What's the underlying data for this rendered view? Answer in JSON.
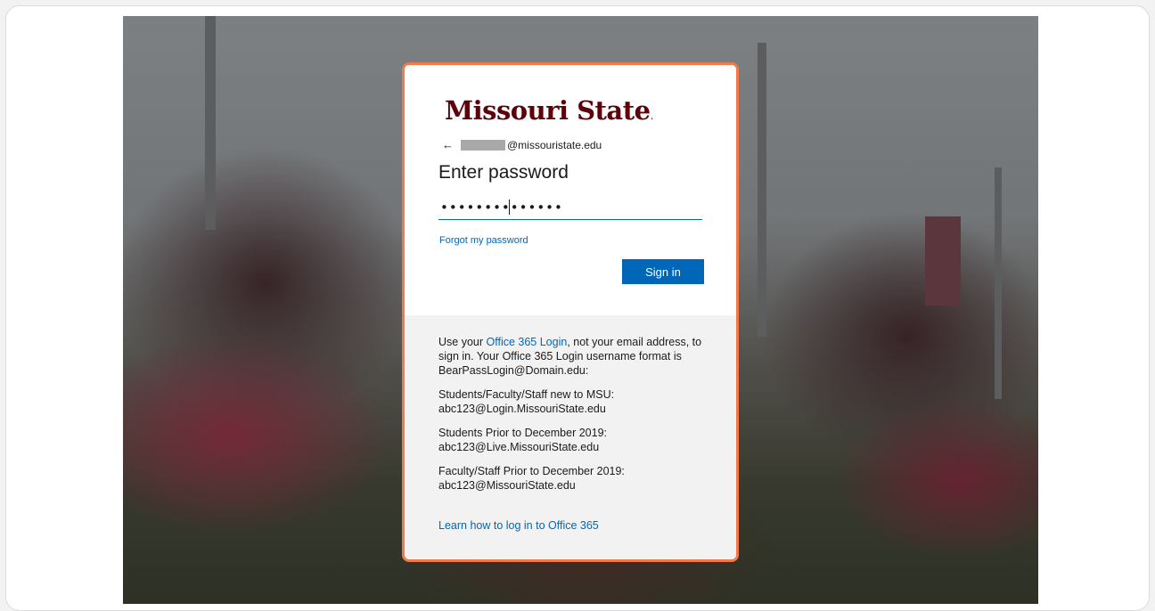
{
  "brand": {
    "name": "Missouri State",
    "mark": ".",
    "color": "#5e0009"
  },
  "identity": {
    "back_icon": "arrow-left-icon",
    "email_domain": "@missouristate.edu"
  },
  "login": {
    "heading": "Enter password",
    "password_mask": "••••••••••••••",
    "forgot_link": "Forgot my password",
    "signin_label": "Sign in",
    "accent": "#0067b8"
  },
  "help": {
    "p1_before": "Use your ",
    "p1_link": "Office 365 Login",
    "p1_after": ", not your email address, to sign in. Your Office 365 Login username format is BearPassLogin@Domain.edu:",
    "p2_line1": "Students/Faculty/Staff new to MSU:",
    "p2_line2": "abc123@Login.MissouriState.edu",
    "p3_line1": "Students Prior to December 2019:",
    "p3_line2": "abc123@Live.MissouriState.edu",
    "p4_line1": "Faculty/Staff Prior to December 2019:",
    "p4_line2": "abc123@MissouriState.edu",
    "learn_link": "Learn how to log in to Office 365"
  },
  "colors": {
    "card_border": "#f07a4a",
    "help_bg": "#f2f2f2"
  }
}
